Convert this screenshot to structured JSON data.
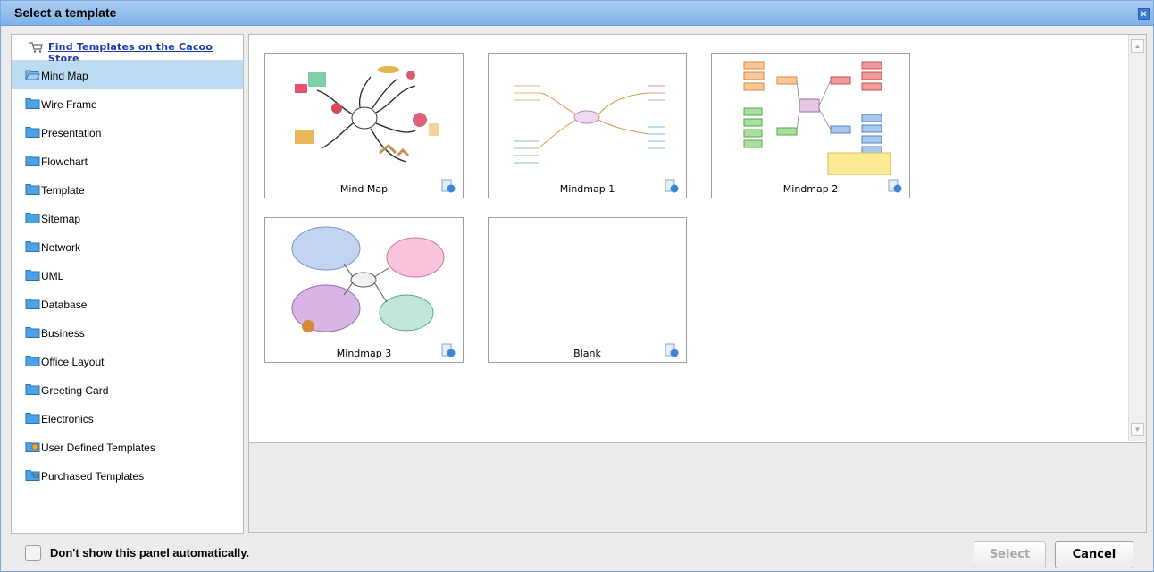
{
  "dialog": {
    "title": "Select a template",
    "close_icon": "close-icon"
  },
  "sidebar": {
    "store_link": "Find Templates on the Cacoo Store",
    "items": [
      {
        "label": "Mind Map",
        "icon": "folder-open-icon",
        "selected": true
      },
      {
        "label": "Wire Frame",
        "icon": "folder-icon"
      },
      {
        "label": "Presentation",
        "icon": "folder-icon"
      },
      {
        "label": "Flowchart",
        "icon": "folder-icon"
      },
      {
        "label": "Template",
        "icon": "folder-icon"
      },
      {
        "label": "Sitemap",
        "icon": "folder-icon"
      },
      {
        "label": "Network",
        "icon": "folder-icon"
      },
      {
        "label": "UML",
        "icon": "folder-icon"
      },
      {
        "label": "Database",
        "icon": "folder-icon"
      },
      {
        "label": "Business",
        "icon": "folder-icon"
      },
      {
        "label": "Office Layout",
        "icon": "folder-icon"
      },
      {
        "label": "Greeting Card",
        "icon": "folder-icon"
      },
      {
        "label": "Electronics",
        "icon": "folder-icon"
      },
      {
        "label": "User Defined Templates",
        "icon": "user-folder-icon"
      },
      {
        "label": "Purchased Templates",
        "icon": "cart-folder-icon"
      }
    ]
  },
  "templates": [
    {
      "name": "Mind Map"
    },
    {
      "name": "Mindmap 1"
    },
    {
      "name": "Mindmap 2"
    },
    {
      "name": "Mindmap 3"
    },
    {
      "name": "Blank"
    }
  ],
  "footer": {
    "checkbox_label": "Don't show this panel automatically.",
    "select_label": "Select",
    "cancel_label": "Cancel"
  },
  "colors": {
    "titlebar": "#8fbdee",
    "selected_row": "#bcdcf4",
    "link": "#1a3aa8"
  }
}
